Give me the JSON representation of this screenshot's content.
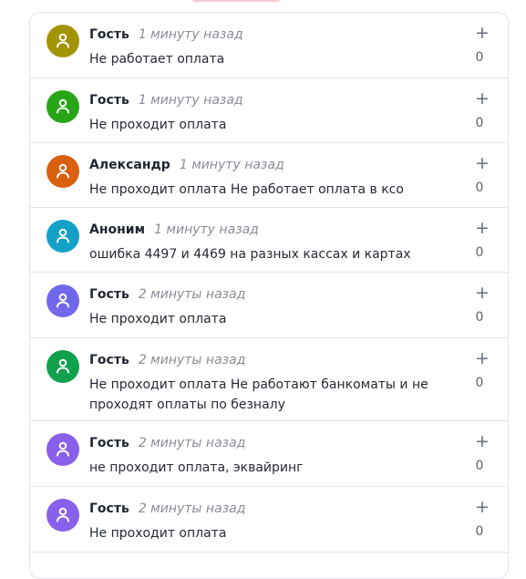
{
  "comments": [
    {
      "name": "Гость",
      "time": "1 минуту назад",
      "text": "Не работает оплата",
      "count": "0",
      "vote": "+",
      "color": "#a39407"
    },
    {
      "name": "Гость",
      "time": "1 минуту назад",
      "text": "Не проходит оплата",
      "count": "0",
      "vote": "+",
      "color": "#27a516"
    },
    {
      "name": "Александр",
      "time": "1 минуту назад",
      "text": "Не проходит оплата Не работает оплата в ксо",
      "count": "0",
      "vote": "+",
      "color": "#d8600f"
    },
    {
      "name": "Аноним",
      "time": "1 минуту назад",
      "text": "ошибка 4497 и 4469 на разных кассах и картах",
      "count": "0",
      "vote": "+",
      "color": "#13a1c7"
    },
    {
      "name": "Гость",
      "time": "2 минуты назад",
      "text": "Не проходит оплата",
      "count": "0",
      "vote": "+",
      "color": "#7266e9"
    },
    {
      "name": "Гость",
      "time": "2 минуты назад",
      "text": "Не проходит оплата Не работают банкоматы и не проходят оплаты по безналу",
      "count": "0",
      "vote": "+",
      "color": "#11a14c"
    },
    {
      "name": "Гость",
      "time": "2 минуты назад",
      "text": "не проходит оплата, эквайринг",
      "count": "0",
      "vote": "+",
      "color": "#8960ea"
    },
    {
      "name": "Гость",
      "time": "2 минуты назад",
      "text": "Не проходит оплата",
      "count": "0",
      "vote": "+",
      "color": "#8960ea"
    }
  ]
}
